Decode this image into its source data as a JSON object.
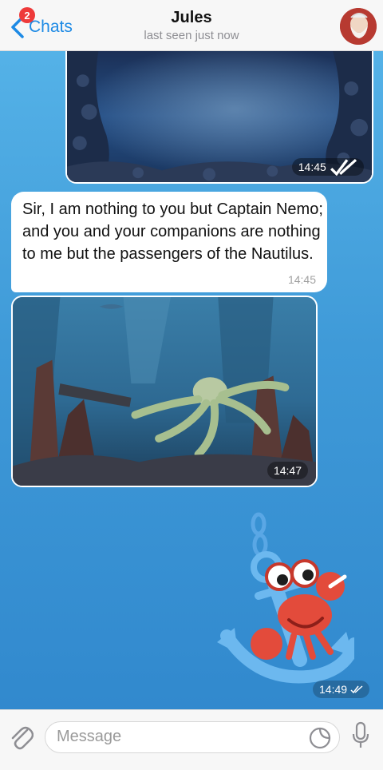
{
  "header": {
    "back_label": "Chats",
    "unread_badge": "2",
    "title": "Jules",
    "status": "last seen just now"
  },
  "messages": {
    "photo1_time": "14:45",
    "text": "Sir, I am nothing to you but Captain Nemo; and you and your companions are nothing to me but the passengers of the Nautilus.",
    "text_time": "14:45",
    "photo2_time": "14:47",
    "sticker_time": "14:49"
  },
  "input": {
    "placeholder": "Message"
  },
  "colors": {
    "accent": "#1d8ae5",
    "badge": "#ee3a3a",
    "background_top": "#58b6ea",
    "background_bottom": "#2f86cc"
  },
  "icons": [
    "chevron-left-icon",
    "avatar",
    "double-check-icon",
    "paperclip-icon",
    "sticker-icon",
    "microphone-icon"
  ]
}
